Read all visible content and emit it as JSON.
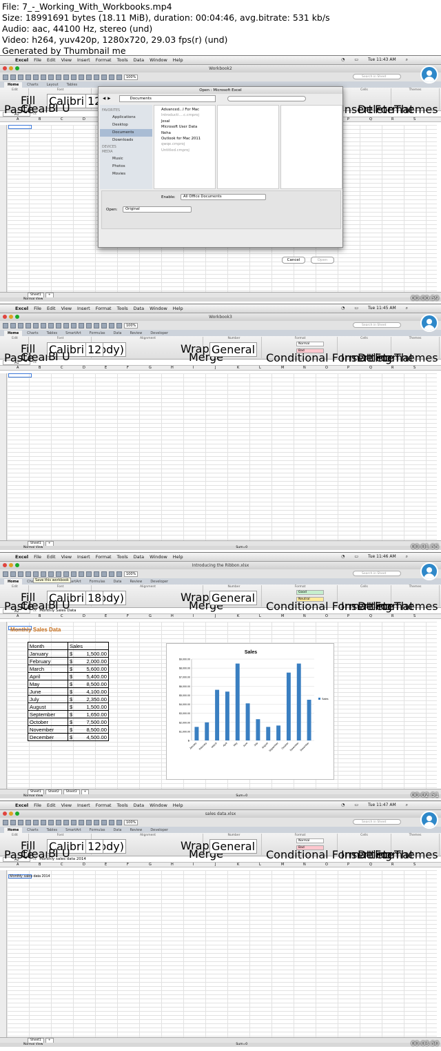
{
  "header": {
    "file": "File: 7_-_Working_With_Workbooks.mp4",
    "size": "Size: 18991691 bytes (18.11 MiB), duration: 00:04:46, avg.bitrate: 531 kb/s",
    "audio": "Audio: aac, 44100 Hz, stereo (und)",
    "video": "Video: h264, yuv420p, 1280x720, 29.03 fps(r) (und)",
    "generated": "Generated by Thumbnail me"
  },
  "menu": {
    "apple": "",
    "items": [
      "Excel",
      "File",
      "Edit",
      "View",
      "Insert",
      "Format",
      "Tools",
      "Data",
      "Window",
      "Help"
    ]
  },
  "frames": [
    {
      "clock": "Tue 11:43 AM",
      "title": "Workbook2",
      "stamp": "00:00:59",
      "namebox": "A1",
      "formula": ""
    },
    {
      "clock": "Tue 11:45 AM",
      "title": "Workbook3",
      "stamp": "00:01:55",
      "namebox": "A1",
      "formula": ""
    },
    {
      "clock": "Tue 11:46 AM",
      "title": "Introducing the Ribbon.xlsx",
      "stamp": "00:02:51",
      "namebox": "A2",
      "formula": "Monthly Sales Data",
      "tooltip": "Save this workbook"
    },
    {
      "clock": "Tue 11:47 AM",
      "title": "sales data.xlsx",
      "stamp": "00:03:50",
      "namebox": "A2",
      "formula": "Monthly sales data 2014",
      "cell_text": "Monthly sales data 2014"
    }
  ],
  "ribbon": {
    "tabs": [
      "Home",
      "Charts",
      "Tables",
      "SmartArt",
      "Formulas",
      "Data",
      "Review",
      "Developer"
    ],
    "tabs_short": [
      "Home",
      "Charts",
      "Layout",
      "Tables"
    ],
    "font_name": "Calibri (Body)",
    "font_size": "12",
    "font_size_f3": "18",
    "number_format": "General",
    "group_labels": [
      "Edit",
      "Font",
      "Alignment",
      "Number",
      "Format",
      "Cells",
      "Themes"
    ],
    "paste": "Paste",
    "fill": "Fill",
    "clear": "Clear",
    "wrap_text": "Wrap Text",
    "merge": "Merge",
    "cond_fmt": "Conditional Formatting",
    "style_normal": "Normal",
    "style_bad": "Bad",
    "style_good": "Good",
    "style_neutral": "Neutral",
    "insert": "Insert",
    "delete": "Delete",
    "format": "Format",
    "themes": "Themes",
    "zoom": "100%",
    "search_placeholder": "Search in Sheet"
  },
  "dialog": {
    "title": "Open : Microsoft Excel",
    "location": "Documents",
    "favorites_label": "FAVORITES",
    "favorites": [
      "Applications",
      "Desktop",
      "Documents",
      "Downloads"
    ],
    "devices_label": "DEVICES",
    "media_label": "MEDIA",
    "media": [
      "Music",
      "Photos",
      "Movies"
    ],
    "files": [
      {
        "name": "Advanced...l For Mac",
        "dim": false
      },
      {
        "name": "Introducti....c.cmproj",
        "dim": true
      },
      {
        "name": "Jesal",
        "dim": false
      },
      {
        "name": "Microsoft User Data",
        "dim": false
      },
      {
        "name": "Neha",
        "dim": false
      },
      {
        "name": "Outlook for Mac 2011",
        "dim": false
      },
      {
        "name": "qwqe.cmproj",
        "dim": true
      },
      {
        "name": "Untitled.cmproj",
        "dim": true
      }
    ],
    "enable_label": "Enable:",
    "enable_value": "All Office Documents",
    "open_label": "Open:",
    "open_value": "Original",
    "cancel": "Cancel",
    "open_button": "Open"
  },
  "sheet": {
    "columns": [
      "A",
      "B",
      "C",
      "D",
      "E",
      "F",
      "G",
      "H",
      "I",
      "J",
      "K",
      "L",
      "M",
      "N",
      "O",
      "P",
      "Q",
      "R",
      "S"
    ],
    "tab1": "Sheet1",
    "tab2": "Sheet2",
    "tab3": "Sheet3",
    "normal_view": "Normal View",
    "sum": "Sum=0"
  },
  "sales": {
    "heading": "Monthly Sales Data",
    "col_month": "Month",
    "col_sales": "Sales",
    "rows": [
      [
        "January",
        "$",
        "1,500.00"
      ],
      [
        "February",
        "$",
        "2,000.00"
      ],
      [
        "March",
        "$",
        "5,600.00"
      ],
      [
        "April",
        "$",
        "5,400.00"
      ],
      [
        "May",
        "$",
        "8,500.00"
      ],
      [
        "June",
        "$",
        "4,100.00"
      ],
      [
        "July",
        "$",
        "2,350.00"
      ],
      [
        "August",
        "$",
        "1,500.00"
      ],
      [
        "September",
        "$",
        "1,650.00"
      ],
      [
        "October",
        "$",
        "7,500.00"
      ],
      [
        "November",
        "$",
        "8,500.00"
      ],
      [
        "December",
        "$",
        "4,500.00"
      ]
    ]
  },
  "chart_data": {
    "type": "bar",
    "title": "Sales",
    "categories": [
      "January",
      "February",
      "March",
      "April",
      "May",
      "June",
      "July",
      "August",
      "September",
      "October",
      "November",
      "December"
    ],
    "series": [
      {
        "name": "Sales",
        "values": [
          1500,
          2000,
          5600,
          5400,
          8500,
          4100,
          2350,
          1500,
          1650,
          7500,
          8500,
          4500
        ]
      }
    ],
    "ylim": [
      0,
      9000
    ],
    "yticks": [
      "$-",
      "$1,000.00",
      "$2,000.00",
      "$3,000.00",
      "$4,000.00",
      "$5,000.00",
      "$6,000.00",
      "$7,000.00",
      "$8,000.00",
      "$9,000.00"
    ],
    "legend": "right",
    "bar_color": "#3a7fc1",
    "grid": true
  },
  "colors": {
    "heading": "#c8701d",
    "selection": "#3b77d8",
    "bar": "#3a7fc1"
  }
}
